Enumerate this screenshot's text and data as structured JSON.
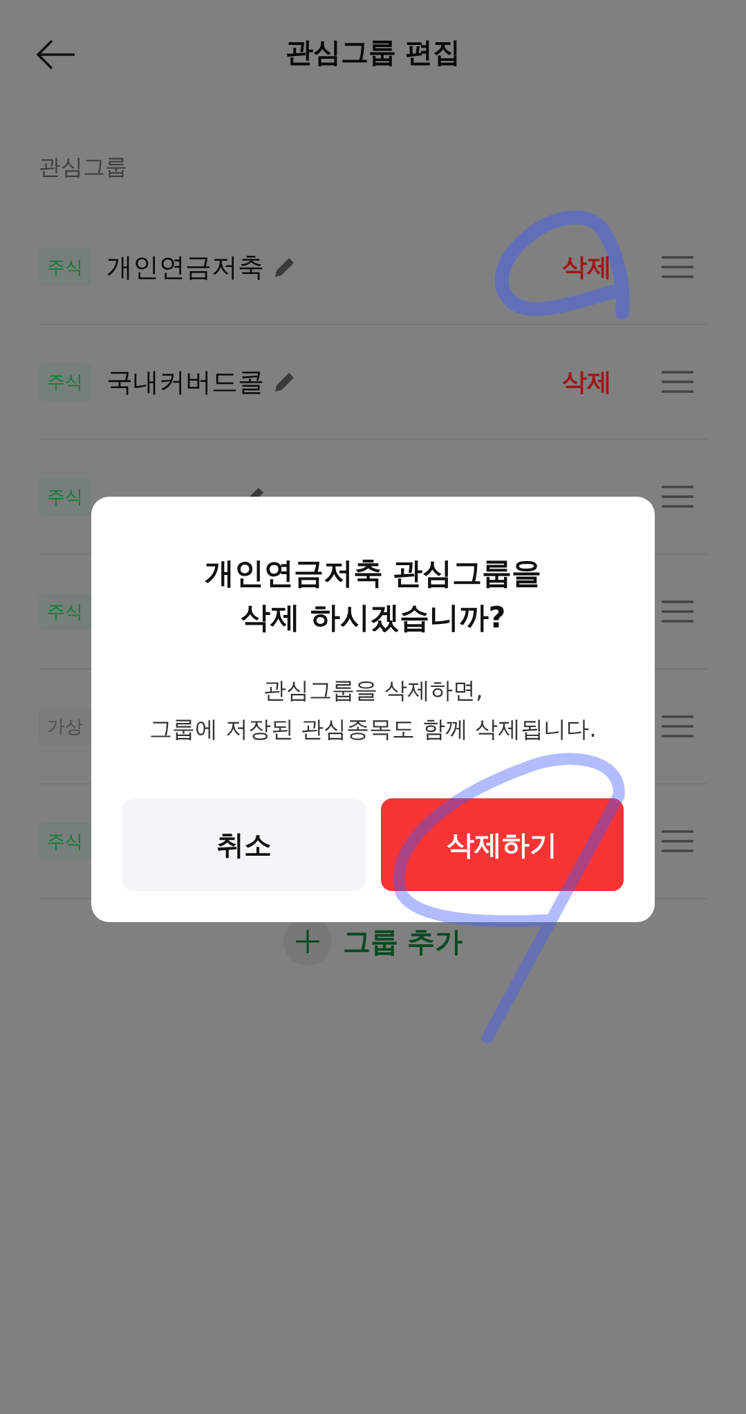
{
  "header": {
    "title": "관심그룹 편집"
  },
  "section_label": "관심그룹",
  "groups": [
    {
      "tag": "주식",
      "color": "#137a3a",
      "name": "개인연금저축",
      "delete": "삭제"
    },
    {
      "tag": "주식",
      "color": "#137a3a",
      "name": "국내커버드콜",
      "delete": "삭제"
    },
    {
      "tag": "주식",
      "color": "#137a3a"
    },
    {
      "tag": "주식",
      "color": "#137a3a"
    },
    {
      "tag": "가상",
      "color": "#4e4e4e"
    },
    {
      "tag": "주식",
      "color": "#137a3a"
    }
  ],
  "add_group": "그룹 추가",
  "dialog": {
    "title_lines": [
      "개인연금저축 관심그룹을",
      "삭제 하시겠습니까?"
    ],
    "message_lines": [
      "관심그룹을 삭제하면,",
      "그룹에 저장된 관심종목도 함께 삭제됩니다."
    ],
    "buttons": [
      {
        "label": "취소",
        "kind": "cancel"
      },
      {
        "label": "삭제하기",
        "kind": "confirm"
      }
    ]
  }
}
